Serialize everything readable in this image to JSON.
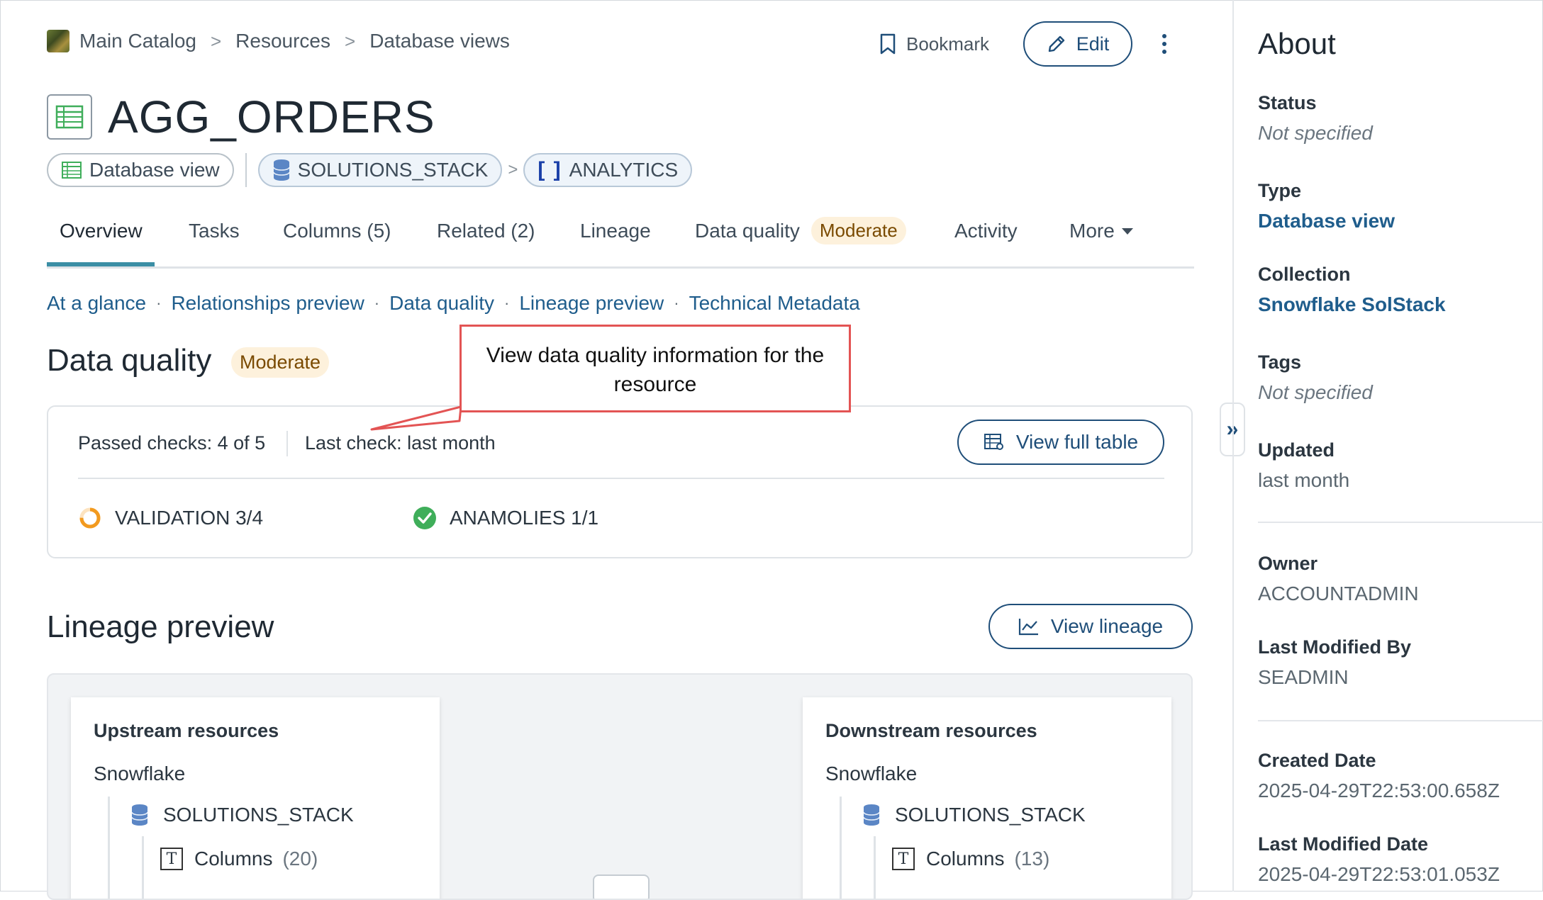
{
  "breadcrumb": {
    "items": [
      "Main Catalog",
      "Resources",
      "Database views"
    ],
    "separator": ">"
  },
  "actions": {
    "bookmark": "Bookmark",
    "edit": "Edit"
  },
  "title": "AGG_ORDERS",
  "chips": {
    "type": "Database view",
    "schema_db": "SOLUTIONS_STACK",
    "schema": "ANALYTICS"
  },
  "tabs": {
    "overview": "Overview",
    "tasks": "Tasks",
    "columns": "Columns (5)",
    "related": "Related (2)",
    "lineage": "Lineage",
    "data_quality": "Data quality",
    "data_quality_badge": "Moderate",
    "activity": "Activity",
    "more": "More"
  },
  "anchors": [
    "At a glance",
    "Relationships preview",
    "Data quality",
    "Lineage preview",
    "Technical Metadata"
  ],
  "data_quality": {
    "title": "Data quality",
    "badge": "Moderate",
    "passed": "Passed checks: 4 of 5",
    "last_check": "Last check: last month",
    "view_full_table": "View full table",
    "validation": "VALIDATION 3/4",
    "validation_progress": 0.75,
    "anomalies": "ANAMOLIES 1/1"
  },
  "callout": {
    "text": "View data quality information for the resource"
  },
  "lineage": {
    "title": "Lineage preview",
    "view_lineage": "View lineage",
    "upstream": {
      "title": "Upstream resources",
      "source": "Snowflake",
      "db": "SOLUTIONS_STACK",
      "columns_label": "Columns",
      "columns_count": "(20)"
    },
    "downstream": {
      "title": "Downstream resources",
      "source": "Snowflake",
      "db": "SOLUTIONS_STACK",
      "columns_label": "Columns",
      "columns_count": "(13)"
    }
  },
  "sidebar": {
    "title": "About",
    "status_label": "Status",
    "status_value": "Not specified",
    "type_label": "Type",
    "type_value": "Database view",
    "collection_label": "Collection",
    "collection_value": "Snowflake SolStack",
    "tags_label": "Tags",
    "tags_value": "Not specified",
    "updated_label": "Updated",
    "updated_value": "last month",
    "owner_label": "Owner",
    "owner_value": "ACCOUNTADMIN",
    "modified_by_label": "Last Modified By",
    "modified_by_value": "SEADMIN",
    "created_label": "Created Date",
    "created_value": "2025-04-29T22:53:00.658Z",
    "last_modified_label": "Last Modified Date",
    "last_modified_value": "2025-04-29T22:53:01.053Z"
  },
  "colors": {
    "accent": "#1f4e79",
    "link": "#1f5d8c",
    "tab_underline": "#3b8ea5",
    "badge_bg": "#fdf1dc",
    "callout_border": "#e35454",
    "success": "#3fae5a",
    "warning": "#f29a1f"
  },
  "icons": [
    "catalog-logo-icon",
    "bookmark-icon",
    "pencil-icon",
    "kebab-icon",
    "table-icon",
    "database-icon",
    "bracket-icon",
    "view-table-icon",
    "progress-ring-icon",
    "check-circle-icon",
    "line-chart-icon",
    "text-column-icon",
    "double-chevron-right-icon"
  ]
}
